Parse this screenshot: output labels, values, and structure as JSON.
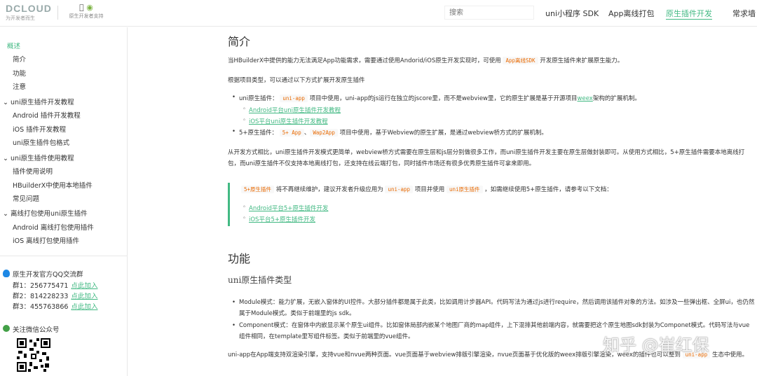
{
  "header": {
    "logo_text": "DCLOUD",
    "logo_sub": "为开发者而生",
    "platform_text": "原生开发者支持",
    "search_placeholder": "搜索",
    "nav": [
      "uni小程序 SDK",
      "App离线打包",
      "原生插件开发",
      "常求墙"
    ]
  },
  "sidebar": {
    "items": [
      {
        "label": "概述",
        "active": true
      },
      {
        "label": "简介"
      },
      {
        "label": "功能"
      },
      {
        "label": "注意"
      },
      {
        "label": "uni原生插件开发教程",
        "section": true
      },
      {
        "label": "Android 插件开发教程"
      },
      {
        "label": "iOS 插件开发教程"
      },
      {
        "label": "uni原生插件包格式"
      },
      {
        "label": "uni原生插件使用教程",
        "section": true
      },
      {
        "label": "插件使用说明"
      },
      {
        "label": "HBuilderX中使用本地插件"
      },
      {
        "label": "常见问题"
      },
      {
        "label": "离线打包使用uni原生插件",
        "section": true
      },
      {
        "label": "Android 离线打包使用插件"
      },
      {
        "label": "iOS 离线打包使用插件"
      }
    ],
    "qq_title": "原生开发官方QQ交流群",
    "qq_groups": [
      {
        "label": "群1：256775471",
        "join": "点此加入"
      },
      {
        "label": "群2：814228233",
        "join": "点此加入"
      },
      {
        "label": "群3：455763866",
        "join": "点此加入"
      }
    ],
    "wechat_title": "关注微信公众号"
  },
  "content": {
    "h_intro": "简介",
    "p1_a": "当HBuilderX中提供的能力无法满足App功能需求，需要通过使用Andorid/iOS原生开发实现时，可使用",
    "p1_code": "App离线SDK",
    "p1_b": "开发原生插件来扩展原生能力。",
    "p2": "根据项目类型，可以通过以下方式扩展开发原生插件",
    "b1_a": "uni原生插件：",
    "b1_code": "uni-app",
    "b1_b": "项目中使用，uni-app的js运行在独立的jscore里，而不是webview里，它的原生扩展是基于开源项目",
    "b1_link": "weex",
    "b1_c": "架构的扩展机制。",
    "b1_sub": [
      "Android平台uni原生插件开发教程",
      "iOS平台uni原生插件开发教程"
    ],
    "b2_a": "5+原生插件：",
    "b2_code1": "5+ App",
    "b2_sep": "、",
    "b2_code2": "Wap2App",
    "b2_b": "项目中使用，基于Webview的原生扩展，是通过webview桥方式的扩展机制。",
    "p3": "从开发方式相比，uni原生插件开发模式更简单，webview桥方式需要在原生层和js层分别做很多工作，而uni原生插件开发主要在原生层做封装即可。从使用方式相比，5+原生插件需要本地离线打包，而uni原生插件不仅支持本地离线打包，还支持在线云端打包，同时插件市场还有很多优秀原生插件可拿来即用。",
    "tip_code1": "5+原生插件",
    "tip_a": "将不再继续维护，建议开发者升级应用为",
    "tip_code2": "uni-app",
    "tip_b": "项目并使用",
    "tip_code3": "uni原生插件",
    "tip_c": "，如需继续使用5+原生插件，请参考以下文档：",
    "tip_links": [
      "Android平台5+原生插件开发",
      "iOS平台5+原生插件开发"
    ],
    "h_func": "功能",
    "h_types": "uni原生插件类型",
    "f1": "Module模式：能力扩展，无嵌入窗体的UI控件。大部分插件都是属于此类，比如调用计步器API。代码写法为通过js进行require，然后调用该插件对象的方法。如涉及一些弹出框、全屏ui，也仍然属于Module模式。类似于前端里的js sdk。",
    "f2": "Component模式：在窗体中内嵌显示某个原生ui组件。比如窗体局部内嵌某个地图厂商的map组件，上下混排其他前端内容，就需要把这个原生地图sdk封装为Componet模式。代码写法与vue组件相同，在template里写组件标签。类似于前端里的vue组件。",
    "p4_a": "uni-app在App端支持双渲染引擎，支持vue和nvue两种页面。vue页面基于webview排版引擎渲染，nvue页面基于优化版的weex排版引擎渲染，weex的插件也可以整到",
    "p4_code": "uni-app",
    "p4_b": "生态中使用。"
  },
  "watermark": "知乎 @崔红保",
  "accent_color": "#42b983",
  "code_color": "#e96900"
}
